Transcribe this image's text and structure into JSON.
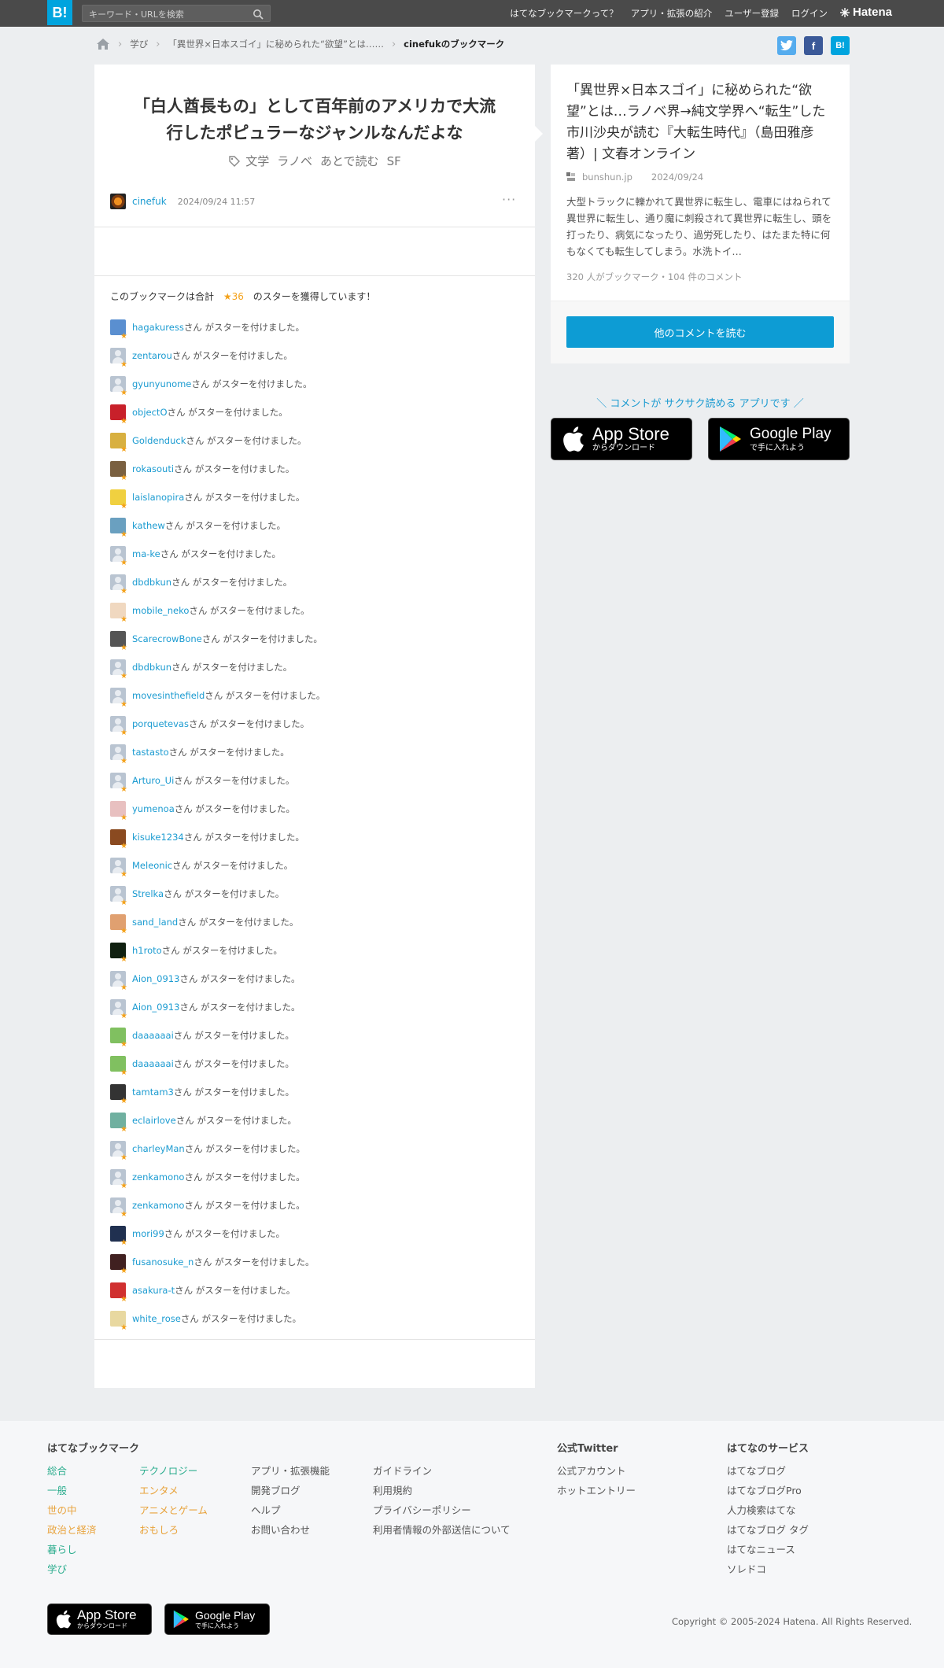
{
  "header": {
    "logo": "B!",
    "search_placeholder": "キーワード・URLを検索",
    "nav": [
      "はてなブックマークって？",
      "アプリ・拡張の紹介",
      "ユーザー登録",
      "ログイン"
    ],
    "hatena_logo": "Hatena"
  },
  "breadcrumb": {
    "items": [
      "学び",
      "「異世界×日本スゴイ」に秘められた“欲望”とは……"
    ],
    "current": "cinefukのブックマーク"
  },
  "share": {
    "twitter": "t",
    "facebook": "f",
    "hatebu": "B!"
  },
  "bookmark": {
    "comment_line1": "「白人酋長もの」として百年前のアメリカで大流",
    "comment_line2": "行したポピュラーなジャンルなんだよな",
    "tags": [
      "文学",
      "ラノベ",
      "あとで読む",
      "SF"
    ],
    "user": "cinefuk",
    "date": "2024/09/24 11:57",
    "more": "···",
    "star_summary_prefix": "このブックマークは合計",
    "star_count": "★36",
    "star_summary_suffix": "のスターを獲得しています！"
  },
  "star_suffix": "さん がスターを付けました。",
  "star_users": [
    "hagakuress",
    "zentarou",
    "gyunyunome",
    "objectO",
    "Goldenduck",
    "rokasouti",
    "laislanopira",
    "kathew",
    "ma-ke",
    "dbdbkun",
    "mobile_neko",
    "ScarecrowBone",
    "dbdbkun",
    "movesinthefield",
    "porquetevas",
    "tastasto",
    "Arturo_Ui",
    "yumenoa",
    "kisuke1234",
    "Meleonic",
    "Strelka",
    "sand_land",
    "h1roto",
    "Aion_0913",
    "Aion_0913",
    "daaaaaai",
    "daaaaaai",
    "tamtam3",
    "eclairlove",
    "charleyMan",
    "zenkamono",
    "zenkamono",
    "mori99",
    "fusanosuke_n",
    "asakura-t",
    "white_rose"
  ],
  "entry": {
    "title": "「異世界×日本スゴイ」に秘められた“欲望”とは…ラノベ界→純文学界へ“転生”した市川沙央が読む『大転生時代』（島田雅彦 著）| 文春オンライン",
    "domain": "bunshun.jp",
    "date": "2024/09/24",
    "description": "大型トラックに轢かれて異世界に転生し、電車にはねられて異世界に転生し、通り魔に刺殺されて異世界に転生し、頭を打ったり、病気になったり、過労死したり、はたまた特に何もなくても転生してしまう。水洗トイ…",
    "stats": "320 人がブックマーク・104 件のコメント",
    "read_button": "他のコメントを読む"
  },
  "app_promo": {
    "tagline": "＼ コメントが サクサク読める アプリです ／",
    "appstore_big": "App Store",
    "appstore_small": "からダウンロード",
    "googleplay_big": "Google Play",
    "googleplay_small": "で手に入れよう"
  },
  "footer": {
    "heading_hatebu": "はてなブックマーク",
    "col1": [
      "総合",
      "一般",
      "世の中",
      "政治と経済",
      "暮らし",
      "学び"
    ],
    "col2": [
      "テクノロジー",
      "エンタメ",
      "アニメとゲーム",
      "おもしろ"
    ],
    "col3": [
      "アプリ・拡張機能",
      "開発ブログ",
      "ヘルプ",
      "お問い合わせ"
    ],
    "col4": [
      "ガイドライン",
      "利用規約",
      "プライバシーポリシー",
      "利用者情報の外部送信について"
    ],
    "heading_twitter": "公式Twitter",
    "twitter_links": [
      "公式アカウント",
      "ホットエントリー"
    ],
    "heading_services": "はてなのサービス",
    "services": [
      "はてなブログ",
      "はてなブログPro",
      "人力検索はてな",
      "はてなブログ タグ",
      "はてなニュース",
      "ソレドコ"
    ],
    "copyright": "Copyright © 2005-2024 Hatena. All Rights Reserved."
  },
  "colors": {
    "brand_blue": "#00a4de",
    "link_blue": "#1b9bd1",
    "star_orange": "#f4a21b",
    "header_bg": "#4a4a4a"
  }
}
